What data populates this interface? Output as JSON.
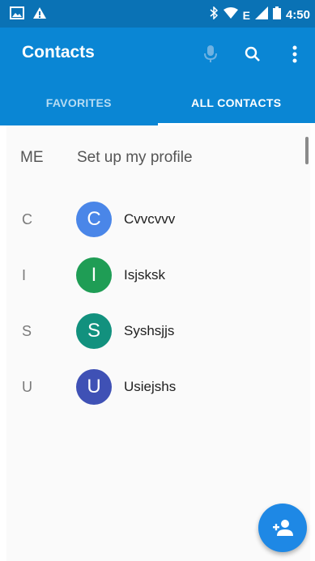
{
  "status_bar": {
    "time": "4:50",
    "left_icons": [
      "image-icon",
      "warning-icon"
    ],
    "right_icons": [
      "bluetooth-icon",
      "wifi-icon",
      "data-e-icon",
      "signal-icon",
      "battery-icon"
    ],
    "data_label": "E"
  },
  "app_bar": {
    "title": "Contacts",
    "actions": [
      "mic-icon",
      "search-icon",
      "more-vert-icon"
    ]
  },
  "tabs": [
    {
      "label": "FAVORITES",
      "active": false
    },
    {
      "label": "ALL CONTACTS",
      "active": true
    }
  ],
  "me": {
    "label": "ME",
    "text": "Set up my profile"
  },
  "contacts": [
    {
      "letter": "C",
      "initial": "C",
      "name": "Cvvcvvv",
      "color": "#4a86e8"
    },
    {
      "letter": "I",
      "initial": "I",
      "name": "Isjsksk",
      "color": "#1f9d55"
    },
    {
      "letter": "S",
      "initial": "S",
      "name": "Syshsjjs",
      "color": "#12917e"
    },
    {
      "letter": "U",
      "initial": "U",
      "name": "Usiejshs",
      "color": "#3f51b5"
    }
  ],
  "fab": {
    "icon": "add-person-icon"
  },
  "colors": {
    "status_bar": "#0a72b5",
    "app_bar": "#0a86d4",
    "fab": "#1e88e5"
  }
}
